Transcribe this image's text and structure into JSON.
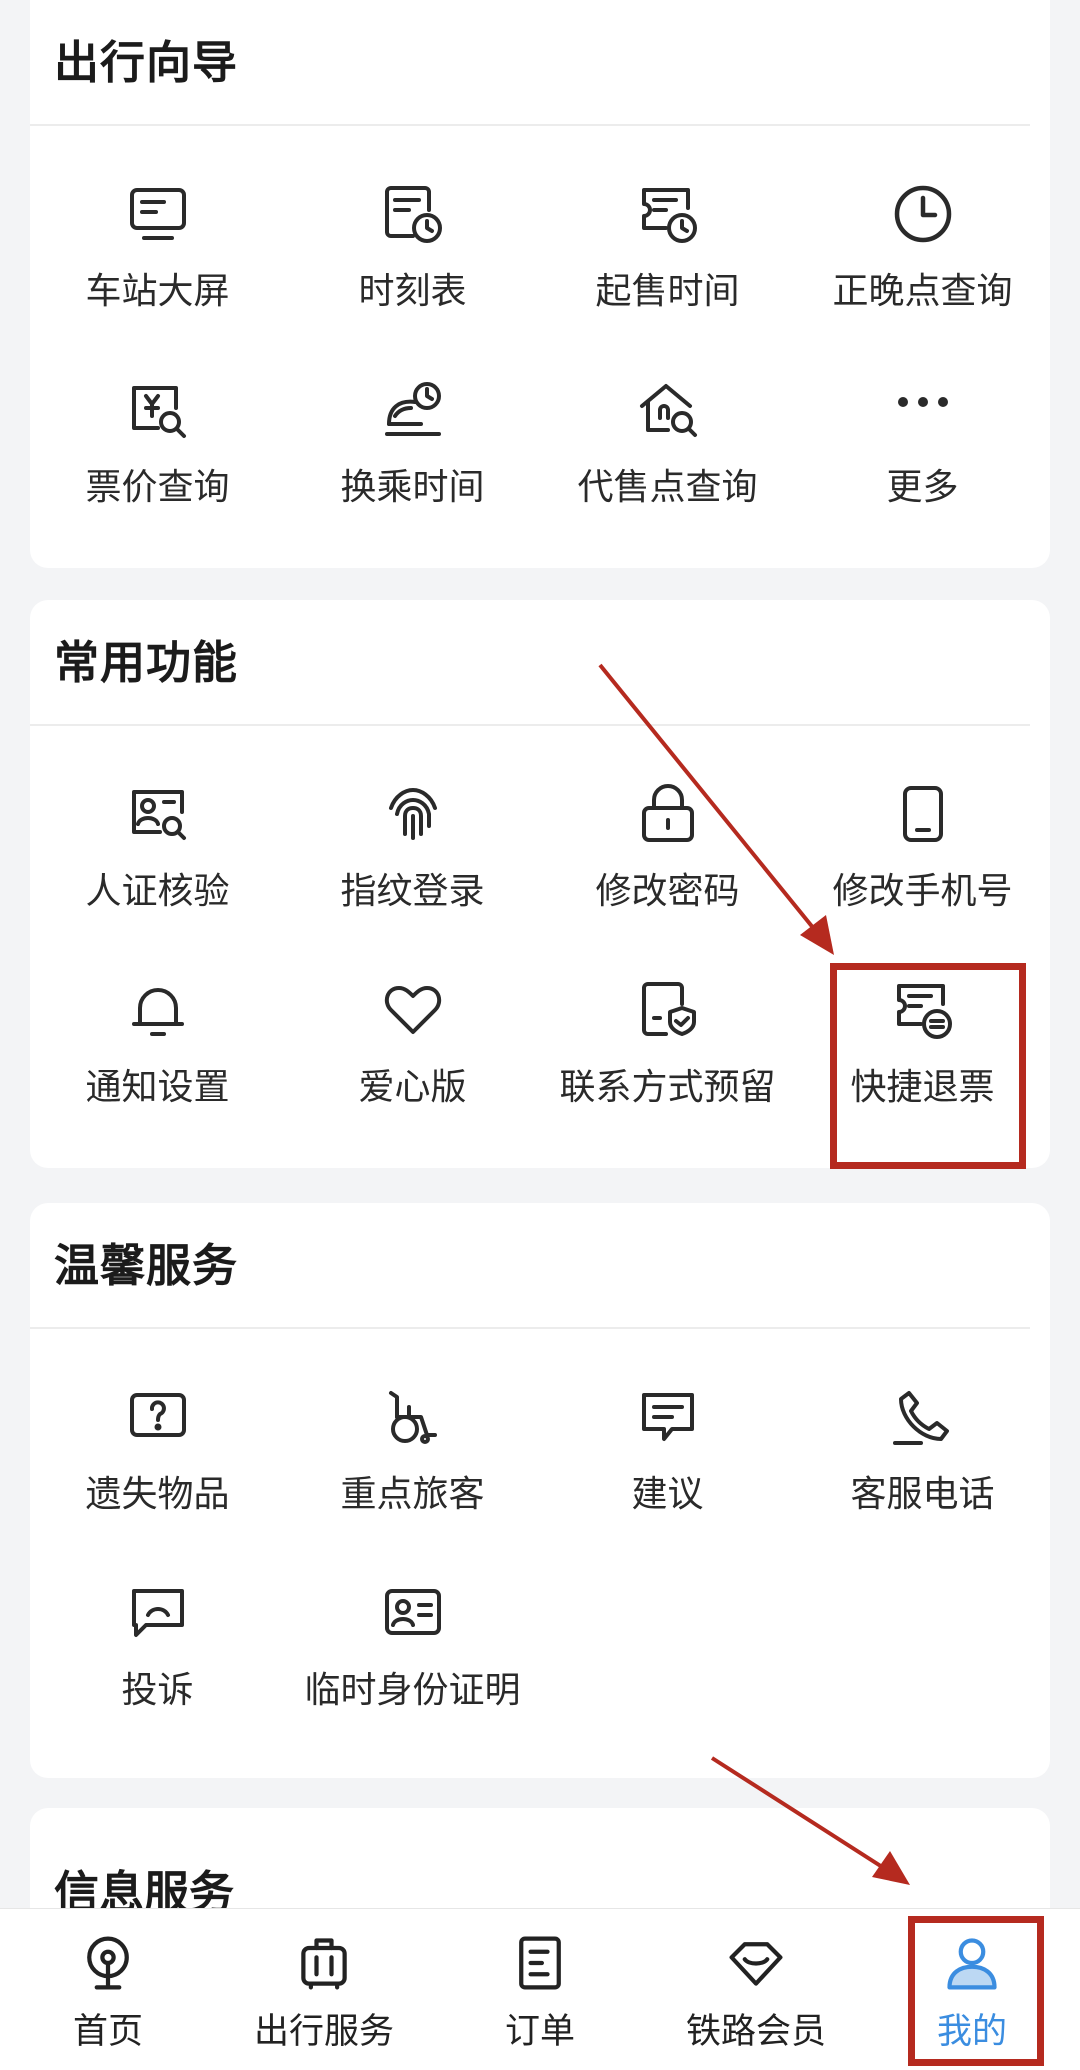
{
  "sections": {
    "travel_guide": {
      "title": "出行向导",
      "items": [
        {
          "label": "车站大屏",
          "icon": "station-screen-icon"
        },
        {
          "label": "时刻表",
          "icon": "timetable-icon"
        },
        {
          "label": "起售时间",
          "icon": "sale-time-icon"
        },
        {
          "label": "正晚点查询",
          "icon": "clock-icon"
        },
        {
          "label": "票价查询",
          "icon": "fare-search-icon"
        },
        {
          "label": "换乘时间",
          "icon": "transfer-time-icon"
        },
        {
          "label": "代售点查询",
          "icon": "agency-search-icon"
        },
        {
          "label": "更多",
          "icon": "more-dots-icon"
        }
      ]
    },
    "common_functions": {
      "title": "常用功能",
      "items": [
        {
          "label": "人证核验",
          "icon": "id-verify-icon"
        },
        {
          "label": "指纹登录",
          "icon": "fingerprint-icon"
        },
        {
          "label": "修改密码",
          "icon": "lock-icon"
        },
        {
          "label": "修改手机号",
          "icon": "phone-icon"
        },
        {
          "label": "通知设置",
          "icon": "bell-icon"
        },
        {
          "label": "爱心版",
          "icon": "heart-icon"
        },
        {
          "label": "联系方式预留",
          "icon": "contact-shield-icon"
        },
        {
          "label": "快捷退票",
          "icon": "quick-refund-icon"
        }
      ]
    },
    "warm_services": {
      "title": "温馨服务",
      "items": [
        {
          "label": "遗失物品",
          "icon": "lost-item-icon"
        },
        {
          "label": "重点旅客",
          "icon": "wheelchair-icon"
        },
        {
          "label": "建议",
          "icon": "suggestion-icon"
        },
        {
          "label": "客服电话",
          "icon": "phone-call-icon"
        },
        {
          "label": "投诉",
          "icon": "complaint-icon"
        },
        {
          "label": "临时身份证明",
          "icon": "temp-id-icon"
        }
      ]
    },
    "info_services": {
      "title": "信息服务"
    }
  },
  "tabbar": {
    "items": [
      {
        "label": "首页",
        "icon": "home-rail-icon"
      },
      {
        "label": "出行服务",
        "icon": "luggage-icon"
      },
      {
        "label": "订单",
        "icon": "order-icon"
      },
      {
        "label": "铁路会员",
        "icon": "member-diamond-icon"
      },
      {
        "label": "我的",
        "icon": "user-icon",
        "active": true
      }
    ]
  },
  "colors": {
    "accent": "#3b8de0",
    "highlight": "#b52a1f",
    "background": "#f3f4f6"
  }
}
